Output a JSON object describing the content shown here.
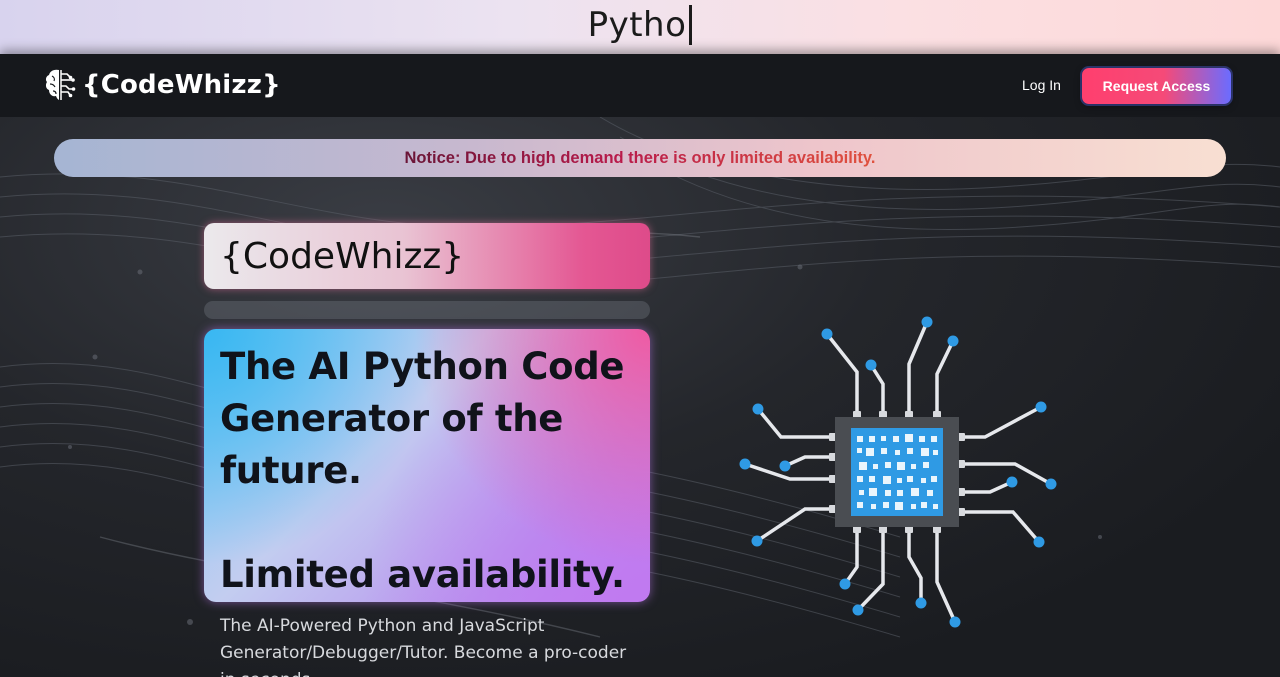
{
  "banner": {
    "typing_text": "Pytho"
  },
  "nav": {
    "brand": "{CodeWhizz}",
    "login_label": "Log In",
    "request_label": "Request Access"
  },
  "notice": {
    "text": "Notice: Due to high demand there is only limited availability."
  },
  "hero": {
    "brand_card": "{CodeWhizz}",
    "headline_lines": [
      "The AI Python Code",
      "Generator of the",
      "future."
    ],
    "headline_tagline": "Limited availability.",
    "subtext": "The AI-Powered Python and JavaScript Generator/Debugger/Tutor. Become a pro-coder in seconds."
  },
  "colors": {
    "accent_pink": "#ff3f6e",
    "accent_blue": "#6b6cff",
    "chip_blue": "#2f9ae4"
  },
  "icons": {
    "logo": "brain-circuit-icon",
    "illustration": "microchip-icon"
  }
}
